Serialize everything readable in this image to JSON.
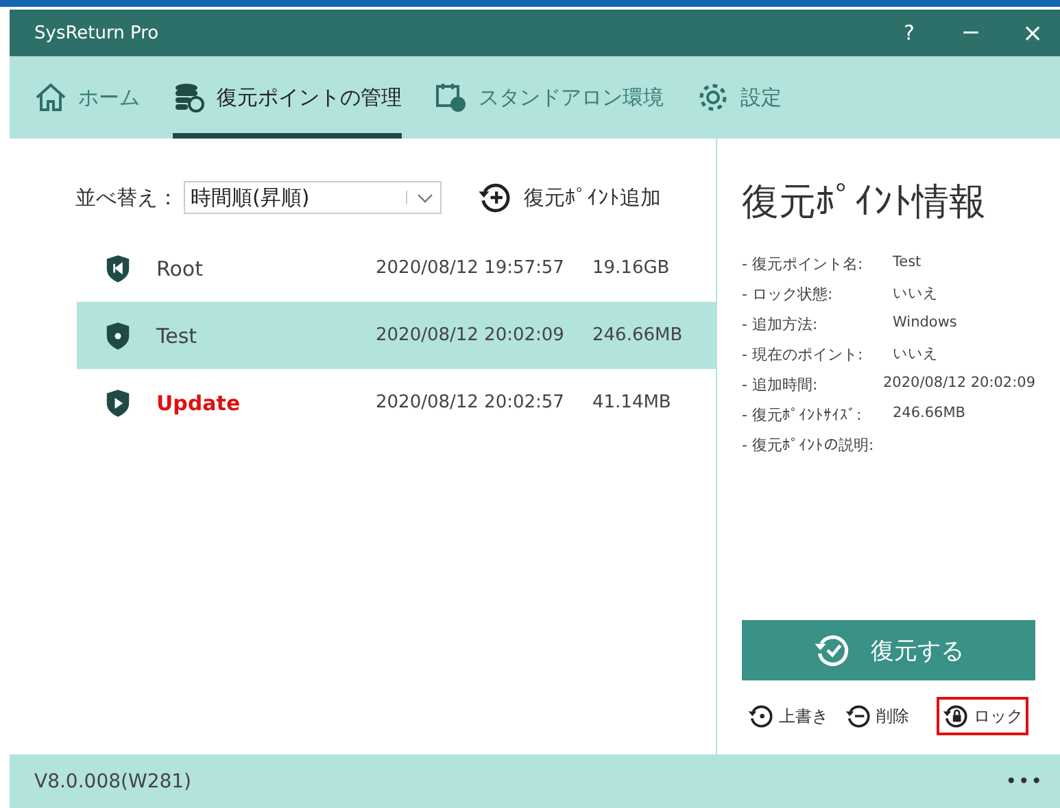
{
  "window": {
    "title": "SysReturn Pro",
    "controls": [
      {
        "kind": "help",
        "label": "?"
      },
      {
        "kind": "minimize",
        "label": "−"
      },
      {
        "kind": "close",
        "label": "×"
      }
    ]
  },
  "tabs": [
    {
      "kind": "home",
      "label": "ホーム",
      "selected": false
    },
    {
      "kind": "points",
      "label": "復元ポイントの管理",
      "selected": true
    },
    {
      "kind": "standalone",
      "label": "スタンドアロン環境",
      "selected": false
    },
    {
      "kind": "settings",
      "label": "設定",
      "selected": false
    }
  ],
  "sort": {
    "label": "並べ替え：",
    "value": "時間順(昇順)"
  },
  "add_button": "復元ﾎﾟｲﾝﾄ追加",
  "points": [
    {
      "kind": "root",
      "name": "Root",
      "time": "2020/08/12 19:57:57",
      "size": "19.16GB",
      "selected": false
    },
    {
      "kind": "normal",
      "name": "Test",
      "time": "2020/08/12 20:02:09",
      "size": "246.66MB",
      "selected": true
    },
    {
      "kind": "update",
      "name": "Update",
      "time": "2020/08/12 20:02:57",
      "size": "41.14MB",
      "selected": false
    }
  ],
  "info": {
    "title": "復元ﾎﾟｲﾝﾄ情報",
    "fields": [
      {
        "label": "- 復元ポイント名:",
        "value": "Test"
      },
      {
        "label": "- ロック状態:",
        "value": "いいえ"
      },
      {
        "label": "- 追加方法:",
        "value": "Windows"
      },
      {
        "label": "- 現在のポイント:",
        "value": "いいえ"
      },
      {
        "label": "- 追加時間:",
        "value": "2020/08/12 20:02:09"
      },
      {
        "label": "- 復元ﾎﾟｲﾝﾄｻｲｽﾞ:",
        "value": "246.66MB"
      },
      {
        "label": "- 復元ﾎﾟｲﾝﾄの説明:"
      }
    ]
  },
  "restore_button": "復元する",
  "actions": [
    {
      "kind": "overwrite",
      "label": "上書き",
      "highlighted": false
    },
    {
      "kind": "delete",
      "label": "削除",
      "highlighted": false
    },
    {
      "kind": "lock",
      "label": "ロック",
      "highlighted": true
    }
  ],
  "status_bar": {
    "version": "V8.0.008(W281)",
    "menu": "•••"
  }
}
